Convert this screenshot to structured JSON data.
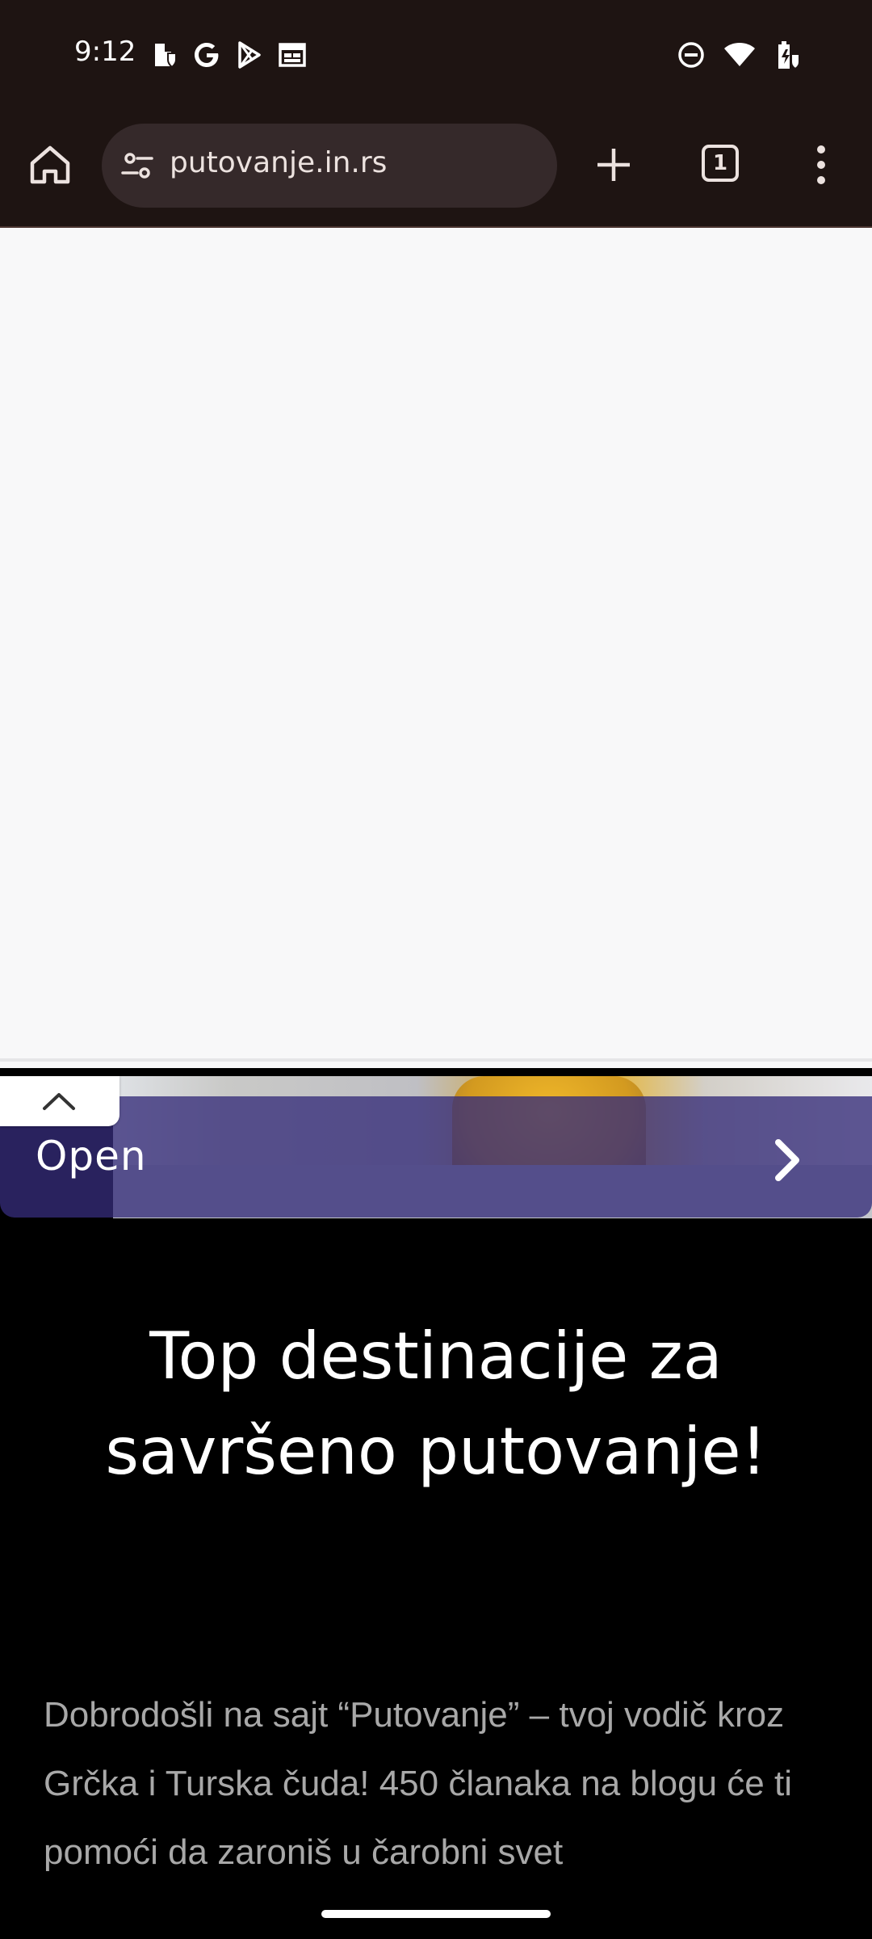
{
  "status_bar": {
    "time": "9:12",
    "left_icons": [
      "shield-notification-icon",
      "google-g-icon",
      "play-store-icon",
      "calendar-icon"
    ],
    "right_icons": [
      "do-not-disturb-icon",
      "wifi-icon",
      "battery-charging-icon"
    ]
  },
  "browser": {
    "url": "putovanje.in.rs",
    "tab_count": "1"
  },
  "ad": {
    "open_label": "Open"
  },
  "page": {
    "headline": "Top destinacije za savršeno putovanje!",
    "intro": "Dobrodošli na sajt “Putovanje” – tvoj vodič kroz Grčka i Turska čuda! 450 članaka na blogu će ti pomoći da zaroniš u čarobni svet"
  },
  "colors": {
    "toolbar_bg": "#1e1412",
    "omnibox_bg": "#35292a",
    "ad_overlay": "#342b78",
    "page_bg": "#000000"
  }
}
